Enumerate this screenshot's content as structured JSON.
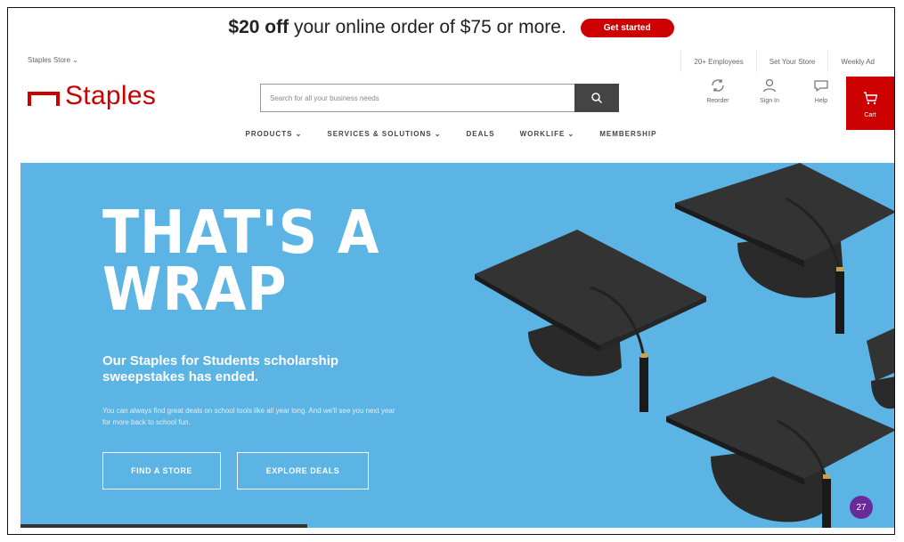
{
  "promo": {
    "amount": "$20 off",
    "text": " your online order of $75 or more.",
    "cta": "Get started"
  },
  "utility": {
    "store": "Staples Store ⌄",
    "links": [
      "20+ Employees",
      "Set Your Store",
      "Weekly Ad"
    ]
  },
  "header": {
    "logo": "Staples",
    "search_placeholder": "Search for all your business needs",
    "icons": [
      {
        "label": "Reorder",
        "icon": "reorder-icon"
      },
      {
        "label": "Sign In",
        "icon": "user-icon"
      },
      {
        "label": "Help",
        "icon": "chat-icon"
      }
    ],
    "cart_label": "Cart"
  },
  "nav": [
    "PRODUCTS ⌄",
    "SERVICES & SOLUTIONS ⌄",
    "DEALS",
    "WORKLIFE ⌄",
    "MEMBERSHIP"
  ],
  "hero": {
    "title_line1": "THAT'S A",
    "title_line2": "WRAP",
    "subtitle": "Our Staples for Students scholarship sweepstakes has ended.",
    "body": "You can always find great deals on school tools like all year long. And we'll see you next year for more back to school fun.",
    "btn_store": "FIND A STORE",
    "btn_deals": "EXPLORE DEALS",
    "badge": "27"
  },
  "colors": {
    "brand": "#cc0000",
    "hero_bg": "#5bb4e3",
    "badge": "#6a2a9a"
  }
}
